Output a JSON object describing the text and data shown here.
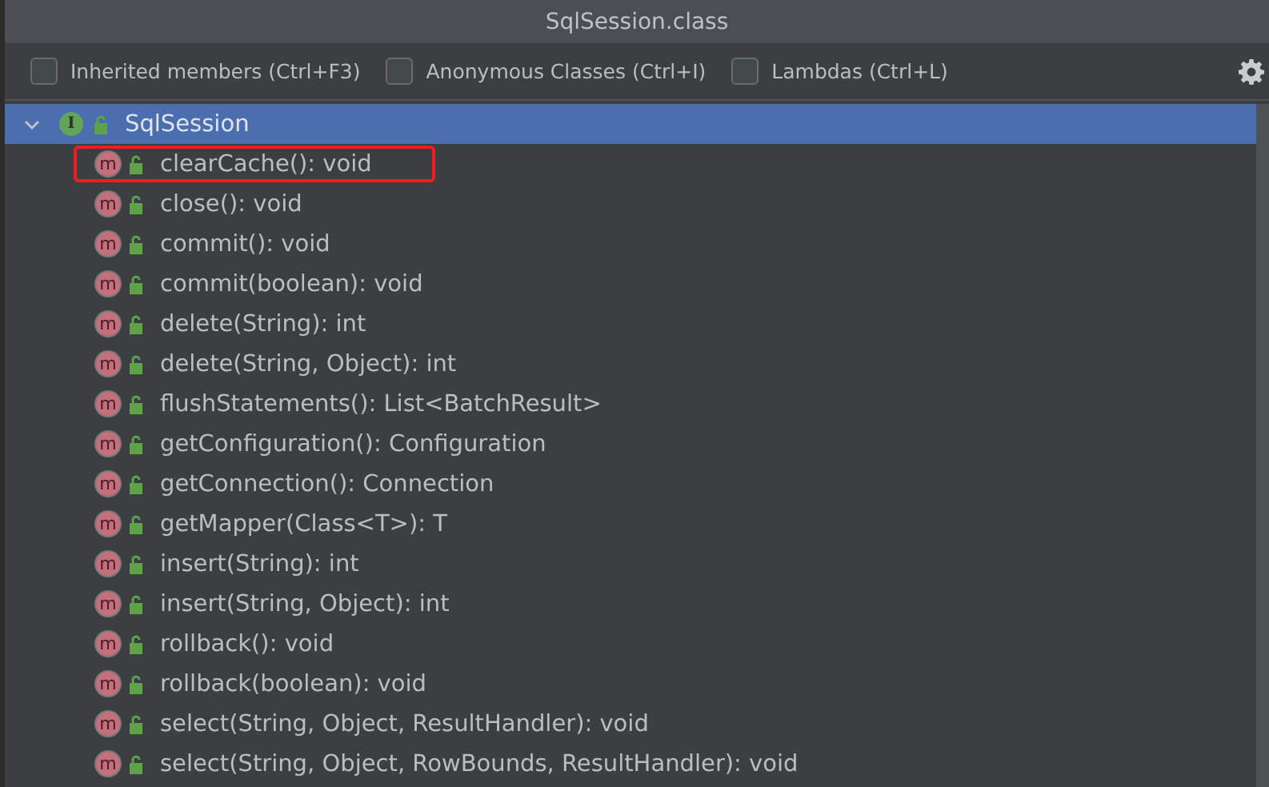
{
  "window": {
    "title": "SqlSession.class"
  },
  "filters": [
    {
      "label": "Inherited members (Ctrl+F3)",
      "checked": false
    },
    {
      "label": "Anonymous Classes (Ctrl+I)",
      "checked": false
    },
    {
      "label": "Lambdas (Ctrl+L)",
      "checked": false
    }
  ],
  "tree": {
    "badge": "I",
    "label": "SqlSession",
    "selected": true,
    "expanded": true,
    "children": [
      {
        "badge": "m",
        "label": "clearCache(): void",
        "highlighted": true
      },
      {
        "badge": "m",
        "label": "close(): void",
        "highlighted": false
      },
      {
        "badge": "m",
        "label": "commit(): void",
        "highlighted": false
      },
      {
        "badge": "m",
        "label": "commit(boolean): void",
        "highlighted": false
      },
      {
        "badge": "m",
        "label": "delete(String): int",
        "highlighted": false
      },
      {
        "badge": "m",
        "label": "delete(String, Object): int",
        "highlighted": false
      },
      {
        "badge": "m",
        "label": "flushStatements(): List<BatchResult>",
        "highlighted": false
      },
      {
        "badge": "m",
        "label": "getConfiguration(): Configuration",
        "highlighted": false
      },
      {
        "badge": "m",
        "label": "getConnection(): Connection",
        "highlighted": false
      },
      {
        "badge": "m",
        "label": "getMapper(Class<T>): T",
        "highlighted": false
      },
      {
        "badge": "m",
        "label": "insert(String): int",
        "highlighted": false
      },
      {
        "badge": "m",
        "label": "insert(String, Object): int",
        "highlighted": false
      },
      {
        "badge": "m",
        "label": "rollback(): void",
        "highlighted": false
      },
      {
        "badge": "m",
        "label": "rollback(boolean): void",
        "highlighted": false
      },
      {
        "badge": "m",
        "label": "select(String, Object, ResultHandler): void",
        "highlighted": false
      },
      {
        "badge": "m",
        "label": "select(String, Object, RowBounds, ResultHandler): void",
        "highlighted": false
      }
    ]
  }
}
